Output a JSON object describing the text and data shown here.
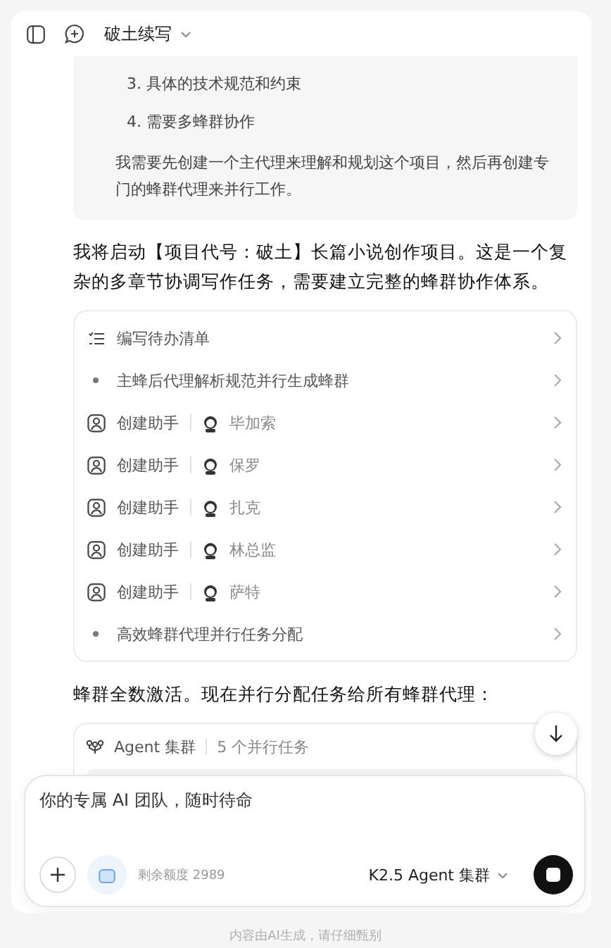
{
  "header": {
    "title": "破土续写"
  },
  "thinking": {
    "items": [
      "3. 具体的技术规范和约束",
      "4. 需要多蜂群协作"
    ],
    "paragraph": "我需要先创建一个主代理来理解和规划这个项目，然后再创建专门的蜂群代理来并行工作。"
  },
  "message_1": "我将启动【项目代号：破土】长篇小说创作项目。这是一个复杂的多章节协调写作任务，需要建立完整的蜂群协作体系。",
  "steps": [
    {
      "kind": "list",
      "label": "编写待办清单"
    },
    {
      "kind": "dot",
      "label": "主蜂后代理解析规范并行生成蜂群"
    },
    {
      "kind": "helper",
      "label": "创建助手",
      "name": "毕加索"
    },
    {
      "kind": "helper",
      "label": "创建助手",
      "name": "保罗"
    },
    {
      "kind": "helper",
      "label": "创建助手",
      "name": "扎克"
    },
    {
      "kind": "helper",
      "label": "创建助手",
      "name": "林总监"
    },
    {
      "kind": "helper",
      "label": "创建助手",
      "name": "萨特"
    },
    {
      "kind": "dot",
      "label": "高效蜂群代理并行任务分配"
    }
  ],
  "message_2": "蜂群全数激活。现在并行分配任务给所有蜂群代理：",
  "agent_card": {
    "title": "Agent 集群",
    "count": "5 个并行任务"
  },
  "composer": {
    "placeholder": "你的专属 AI 团队，随时待命",
    "quota": "剩余额度 2989",
    "model": "K2.5 Agent 集群"
  },
  "footer": "内容由AI生成，请仔细甄别"
}
